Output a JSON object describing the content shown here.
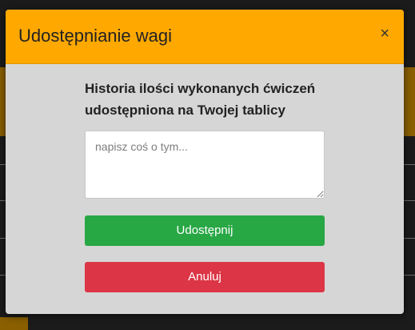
{
  "modal": {
    "title": "Udostępnianie wagi",
    "close_label": "×",
    "message": "Historia ilości wykonanych ćwiczeń udostępniona na Twojej tablicy",
    "textarea_placeholder": "napisz coś o tym...",
    "share_label": "Udostępnij",
    "cancel_label": "Anuluj"
  },
  "colors": {
    "header": "#ffa800",
    "body": "#d6d6d6",
    "share_button": "#28a745",
    "cancel_button": "#dc3545",
    "backdrop": "#1b1b1b"
  }
}
